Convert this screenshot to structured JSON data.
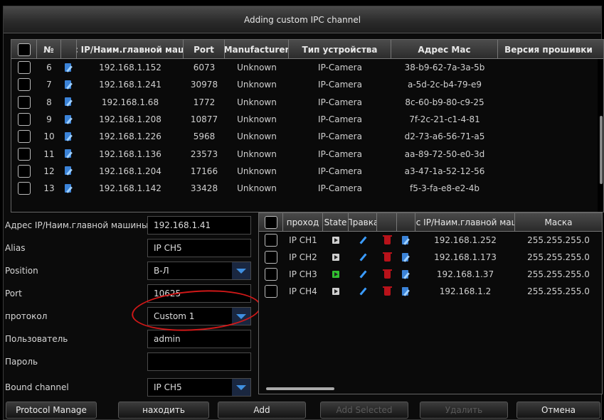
{
  "title": "Adding custom IPC channel",
  "top_table": {
    "headers": [
      "№",
      "с IP/Наим.главной маш",
      "Port",
      "Manufacturer",
      "Тип устройства",
      "Адрес Mac",
      "Версия прошивки"
    ],
    "rows": [
      {
        "num": "6",
        "ip": "192.168.1.152",
        "port": "6073",
        "manufacturer": "Unknown",
        "type": "IP-Camera",
        "mac": "38-b9-62-7a-3a-5b",
        "firmware": ""
      },
      {
        "num": "7",
        "ip": "192.168.1.241",
        "port": "30978",
        "manufacturer": "Unknown",
        "type": "IP-Camera",
        "mac": "a-5d-2c-b4-79-e9",
        "firmware": ""
      },
      {
        "num": "8",
        "ip": "192.168.1.68",
        "port": "1772",
        "manufacturer": "Unknown",
        "type": "IP-Camera",
        "mac": "8c-60-b9-80-c9-25",
        "firmware": ""
      },
      {
        "num": "9",
        "ip": "192.168.1.208",
        "port": "10877",
        "manufacturer": "Unknown",
        "type": "IP-Camera",
        "mac": "7f-2c-21-c1-4-81",
        "firmware": ""
      },
      {
        "num": "10",
        "ip": "192.168.1.226",
        "port": "5968",
        "manufacturer": "Unknown",
        "type": "IP-Camera",
        "mac": "d2-73-a6-56-71-a5",
        "firmware": ""
      },
      {
        "num": "11",
        "ip": "192.168.1.136",
        "port": "23573",
        "manufacturer": "Unknown",
        "type": "IP-Camera",
        "mac": "aa-89-72-50-e0-3d",
        "firmware": ""
      },
      {
        "num": "12",
        "ip": "192.168.1.204",
        "port": "17166",
        "manufacturer": "Unknown",
        "type": "IP-Camera",
        "mac": "a3-47-1a-52-12-56",
        "firmware": ""
      },
      {
        "num": "13",
        "ip": "192.168.1.142",
        "port": "33428",
        "manufacturer": "Unknown",
        "type": "IP-Camera",
        "mac": "f5-3-fa-e8-e2-4b",
        "firmware": ""
      }
    ]
  },
  "form": {
    "address_label": "Адрес IP/Наим.главной машины",
    "address_value": "192.168.1.41",
    "alias_label": "Alias",
    "alias_value": "IP CH5",
    "position_label": "Position",
    "position_value": "В-Л",
    "port_label": "Port",
    "port_value": "10625",
    "protocol_label": "протокол",
    "protocol_value": "Custom 1",
    "user_label": "Пользователь",
    "user_value": "admin",
    "password_label": "Пароль",
    "password_value": "",
    "bound_label": "Bound channel",
    "bound_value": "IP CH5"
  },
  "channel_table": {
    "headers": [
      "проход",
      "State",
      "Правка",
      "ес IP/Наим.главной маш",
      "Маска"
    ],
    "rows": [
      {
        "channel": "IP CH1",
        "state": "off",
        "ip": "192.168.1.252",
        "mask": "255.255.255.0"
      },
      {
        "channel": "IP CH2",
        "state": "off",
        "ip": "192.168.1.173",
        "mask": "255.255.255.0"
      },
      {
        "channel": "IP CH3",
        "state": "on",
        "ip": "192.168.1.37",
        "mask": "255.255.255.0"
      },
      {
        "channel": "IP CH4",
        "state": "off",
        "ip": "192.168.1.2",
        "mask": "255.255.255.0"
      }
    ]
  },
  "buttons": {
    "protocol_manage": "Protocol Manage",
    "find": "находить",
    "add": "Add",
    "add_selected": "Add Selected",
    "delete": "Удалить",
    "cancel": "Отмена"
  },
  "colors": {
    "accent": "#3f8fe0",
    "state_on": "#30c030",
    "annotation": "#d01818",
    "delete": "#b8121a"
  }
}
